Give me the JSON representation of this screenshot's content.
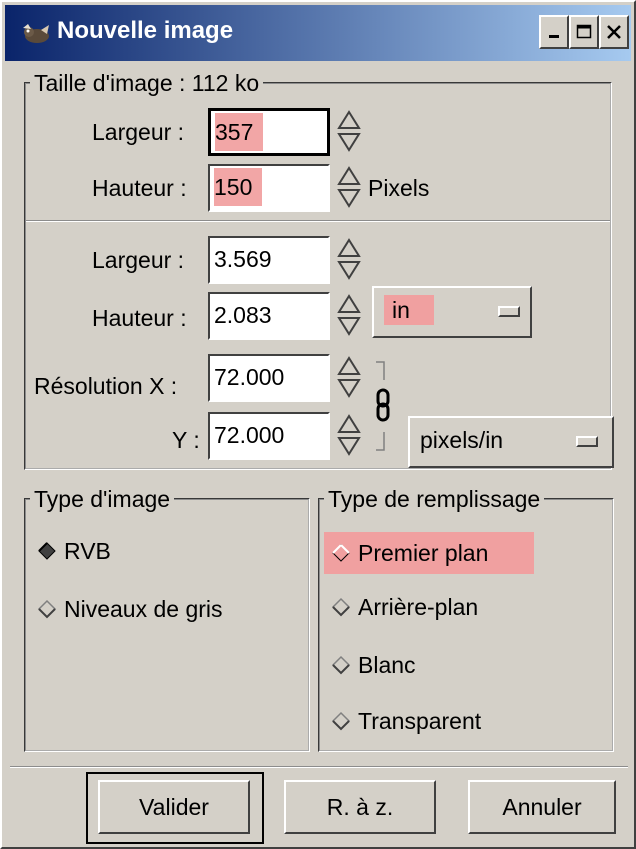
{
  "window": {
    "title": "Nouvelle image",
    "controls": [
      "minimize-icon",
      "maximize-icon",
      "close-icon"
    ]
  },
  "pixel_size": {
    "legend": "Taille d'image : 112 ko",
    "width_label": "Largeur :",
    "width_value": "357",
    "height_label": "Hauteur :",
    "height_value": "150",
    "unit": "Pixels"
  },
  "print_size": {
    "width_label": "Largeur :",
    "width_value": "3.569",
    "height_label": "Hauteur :",
    "height_value": "2.083",
    "unit_selected": "in",
    "res_x_label": "Résolution X :",
    "res_x_value": "72.000",
    "res_y_label": "Y :",
    "res_y_value": "72.000",
    "res_unit_selected": "pixels/in"
  },
  "image_type": {
    "legend": "Type d'image",
    "options": [
      {
        "label": "RVB",
        "selected": true
      },
      {
        "label": "Niveaux de gris",
        "selected": false
      }
    ]
  },
  "fill_type": {
    "legend": "Type de remplissage",
    "options": [
      {
        "label": "Premier plan",
        "selected": true
      },
      {
        "label": "Arrière-plan",
        "selected": false
      },
      {
        "label": "Blanc",
        "selected": false
      },
      {
        "label": "Transparent",
        "selected": false
      }
    ]
  },
  "buttons": {
    "ok": "Valider",
    "reset": "R. à z.",
    "cancel": "Annuler"
  },
  "colors": {
    "dialog_bg": "#d4d0c8",
    "title_start": "#0a246a",
    "title_end": "#a6caf0",
    "highlight": "#f2a6a6"
  }
}
